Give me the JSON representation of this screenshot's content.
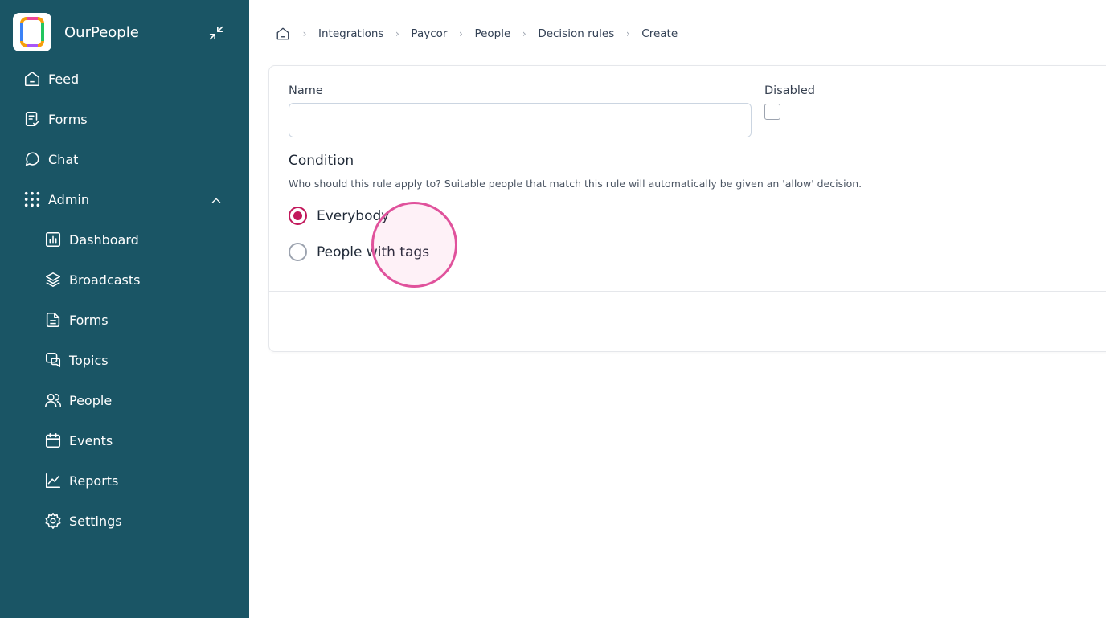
{
  "app": {
    "name": "OurPeople"
  },
  "sidebar": {
    "items": [
      {
        "label": "Feed",
        "icon": "home-icon"
      },
      {
        "label": "Forms",
        "icon": "form-check-icon"
      },
      {
        "label": "Chat",
        "icon": "chat-bubble-icon"
      },
      {
        "label": "Admin",
        "icon": "grid-dots-icon",
        "expanded": true
      }
    ],
    "admin_items": [
      {
        "label": "Dashboard",
        "icon": "chart-icon"
      },
      {
        "label": "Broadcasts",
        "icon": "layers-icon"
      },
      {
        "label": "Forms",
        "icon": "document-icon"
      },
      {
        "label": "Topics",
        "icon": "topics-icon"
      },
      {
        "label": "People",
        "icon": "users-icon"
      },
      {
        "label": "Events",
        "icon": "calendar-icon"
      },
      {
        "label": "Reports",
        "icon": "trend-icon"
      },
      {
        "label": "Settings",
        "icon": "gear-icon"
      }
    ]
  },
  "breadcrumb": {
    "items": [
      "Integrations",
      "Paycor",
      "People",
      "Decision rules",
      "Create"
    ]
  },
  "form": {
    "name_label": "Name",
    "name_value": "",
    "disabled_label": "Disabled",
    "disabled_checked": false,
    "condition_title": "Condition",
    "condition_description": "Who should this rule apply to? Suitable people that match this rule will automatically be given an 'allow' decision.",
    "options": [
      {
        "label": "Everybody",
        "selected": true
      },
      {
        "label": "People with tags",
        "selected": false
      }
    ]
  },
  "colors": {
    "sidebar_bg": "#1a5565",
    "accent": "#c2185b",
    "click_indicator": "#e0529c"
  }
}
